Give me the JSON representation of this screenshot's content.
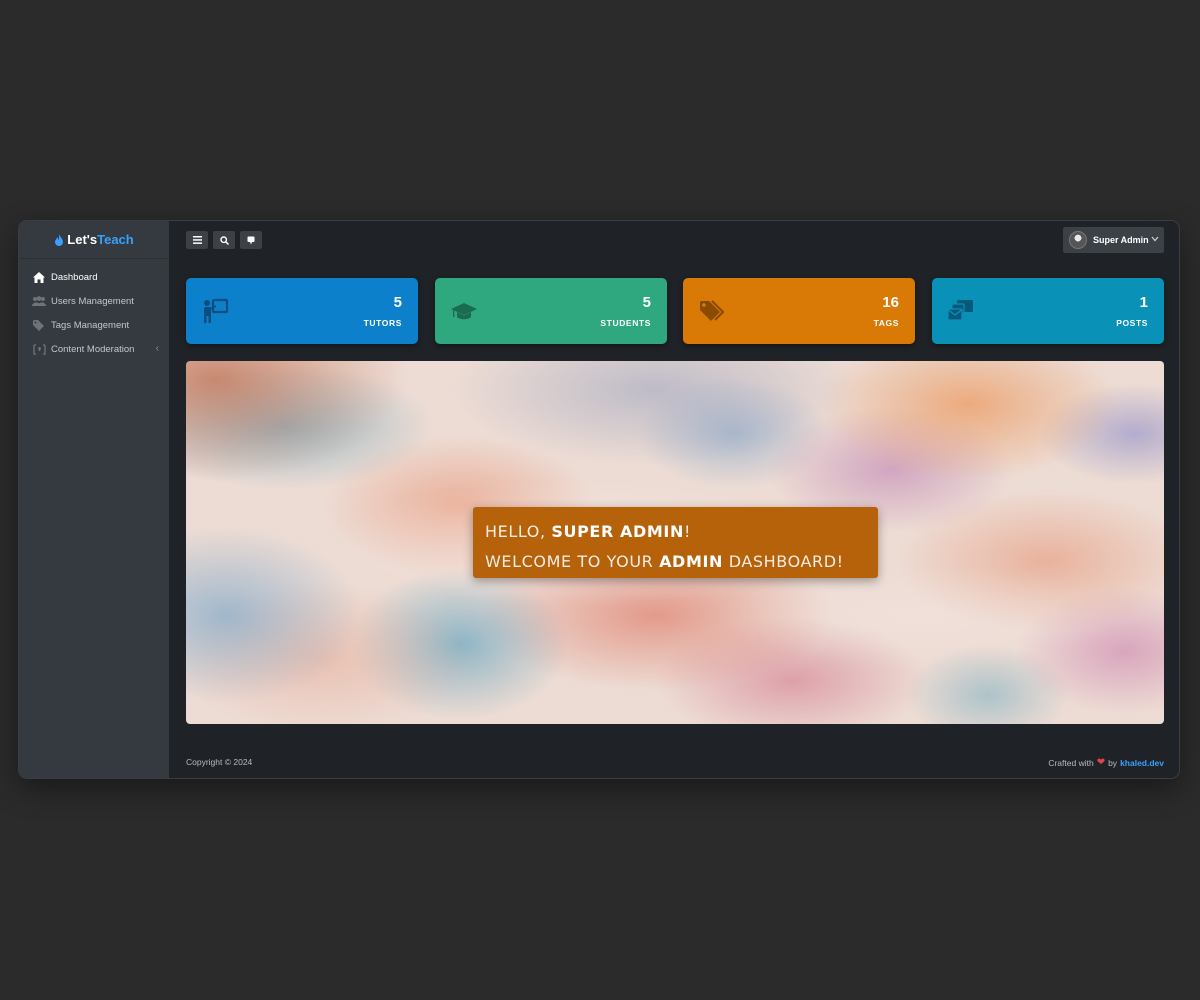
{
  "brand": {
    "part1": "Let's",
    "part2": "Teach",
    "accent": "#3aa0ff"
  },
  "sidebar": {
    "items": [
      {
        "label": "Dashboard",
        "icon": "home-icon",
        "active": true
      },
      {
        "label": "Users Management",
        "icon": "users-icon"
      },
      {
        "label": "Tags Management",
        "icon": "tags-icon"
      },
      {
        "label": "Content Moderation",
        "icon": "moderation-icon",
        "expandable": true
      }
    ]
  },
  "topbar": {
    "buttons": [
      "menu-icon",
      "search-icon",
      "comment-icon"
    ],
    "user": {
      "name": "Super Admin"
    }
  },
  "stats": [
    {
      "value": "5",
      "label": "TUTORS",
      "icon": "teacher-icon",
      "color": "#0d80cc"
    },
    {
      "value": "5",
      "label": "STUDENTS",
      "icon": "graduation-cap-icon",
      "color": "#2fa77f"
    },
    {
      "value": "16",
      "label": "TAGS",
      "icon": "tags-icon",
      "color": "#d97906"
    },
    {
      "value": "1",
      "label": "POSTS",
      "icon": "mail-bulk-icon",
      "color": "#0a91b8"
    }
  ],
  "welcome": {
    "line1_prefix": "HELLO, ",
    "line1_name": "SUPER ADMIN",
    "line1_suffix": "!",
    "line2_prefix": "WELCOME TO YOUR ",
    "line2_bold": "ADMIN",
    "line2_suffix": " DASHBOARD!",
    "color": "#b5620b"
  },
  "footer": {
    "copyright": "Copyright © 2024",
    "crafted": "Crafted with",
    "by": "by",
    "author": "khaled.dev",
    "heart_color": "#e8424b"
  }
}
